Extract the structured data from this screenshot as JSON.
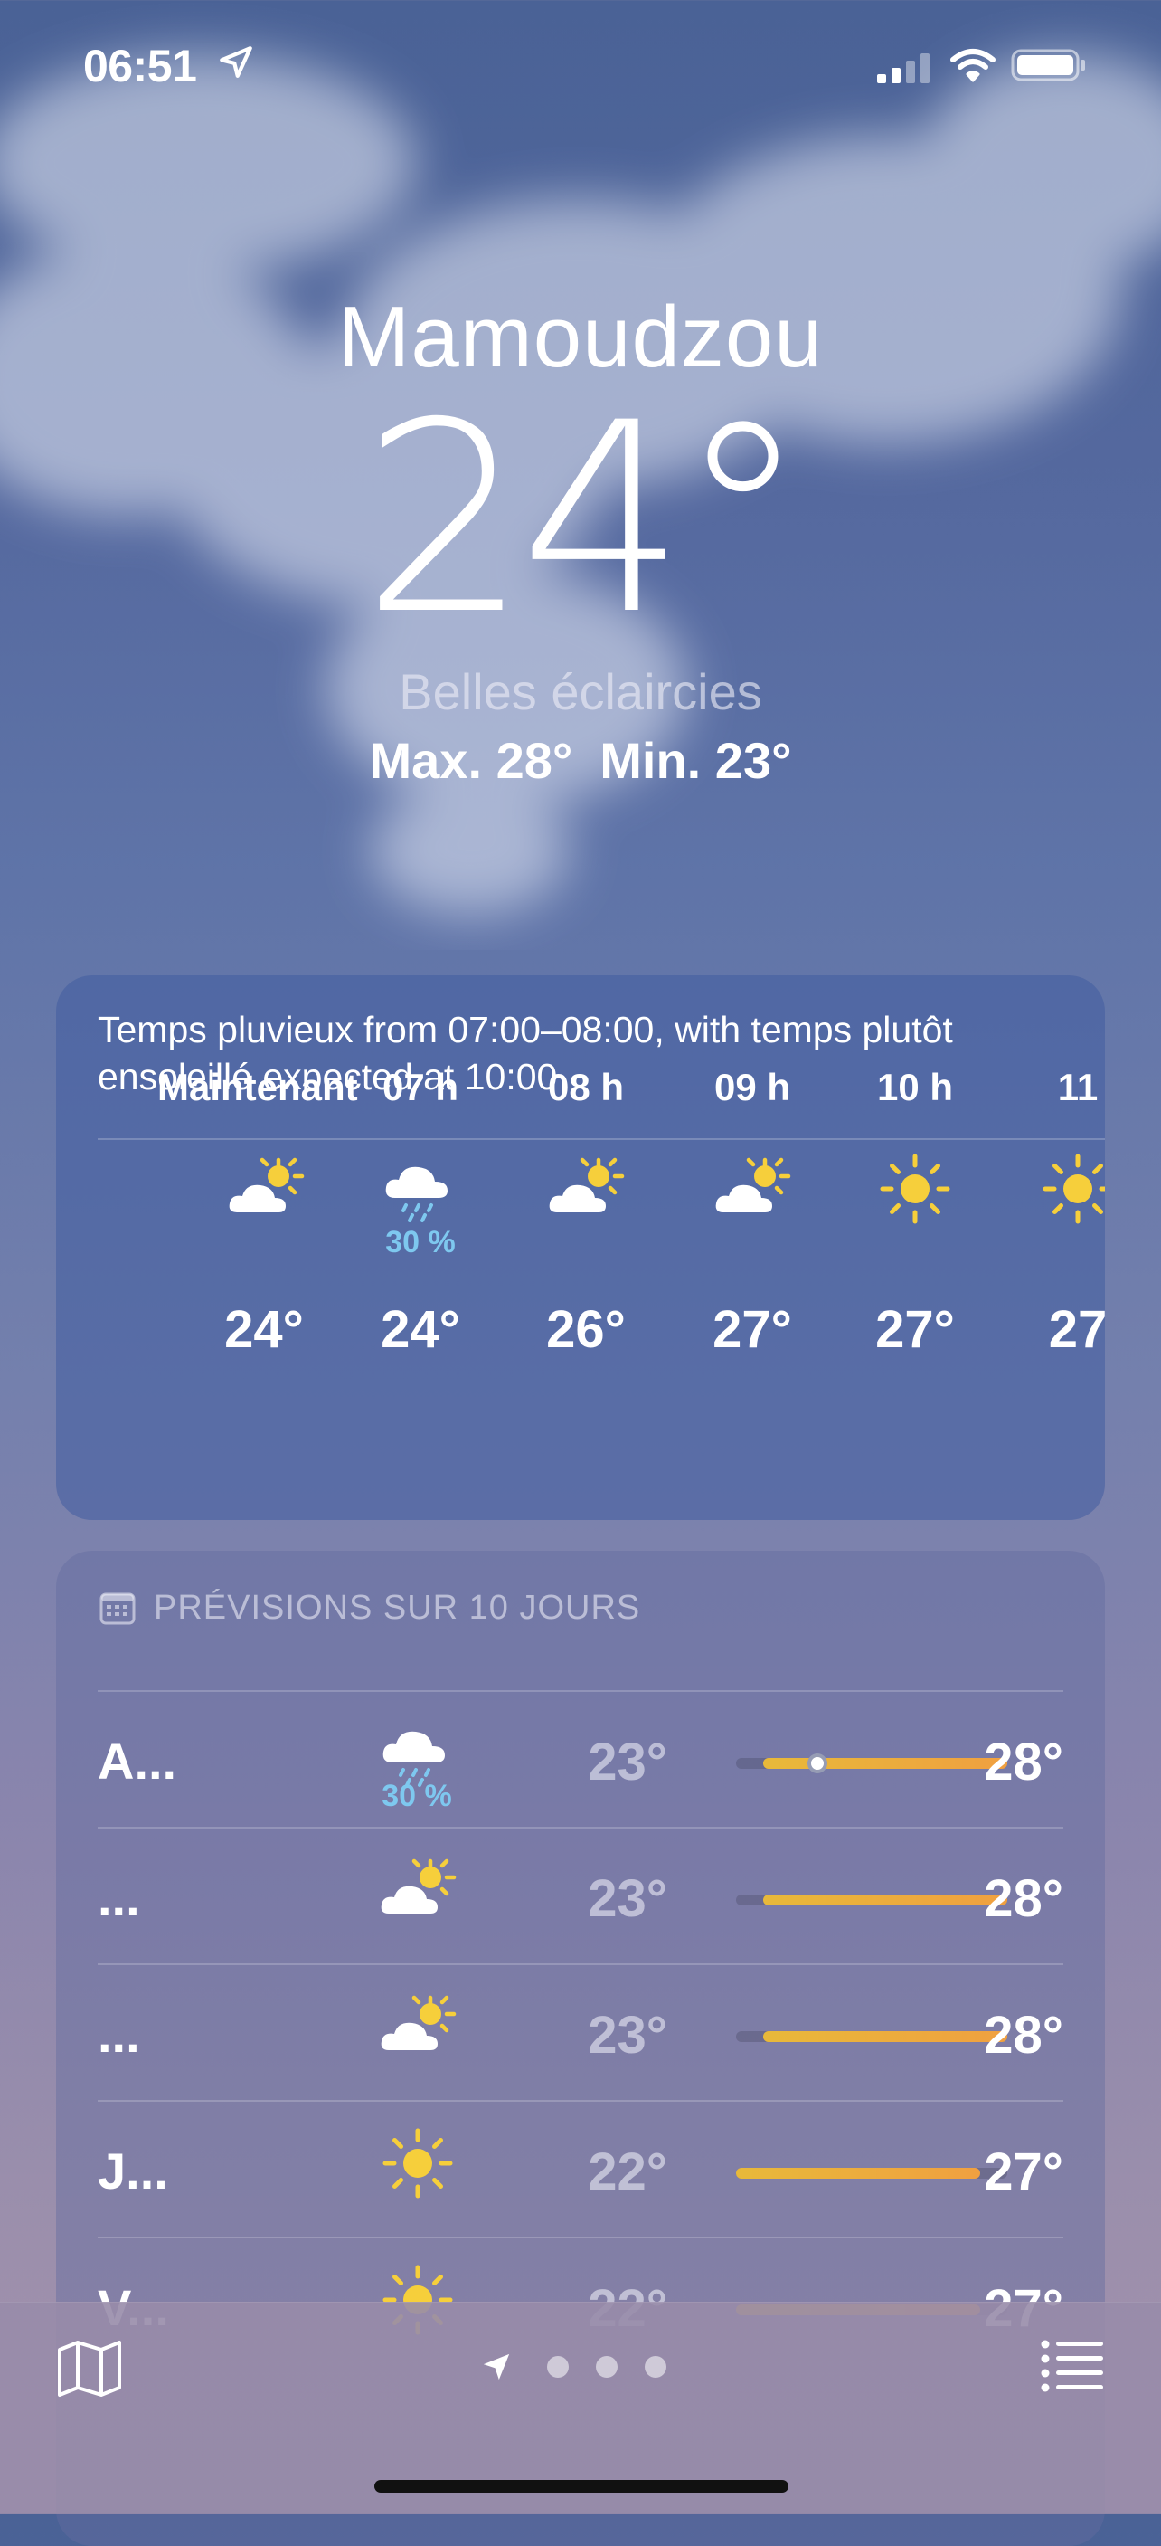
{
  "status_bar": {
    "time": "06:51"
  },
  "current": {
    "city": "Mamoudzou",
    "temperature": "24°",
    "condition": "Belles éclaircies",
    "high": "Max. 28°",
    "low": "Min. 23°"
  },
  "hourly": {
    "summary": "Temps pluvieux from 07:00–08:00, with temps plutôt ensoleillé expected at 10:00",
    "items": [
      {
        "label": "Maintenant",
        "icon": "partly-sunny-icon",
        "precip": "",
        "temp": "24°"
      },
      {
        "label": "07 h",
        "icon": "rain-cloud-icon",
        "precip": "30 %",
        "temp": "24°"
      },
      {
        "label": "08 h",
        "icon": "partly-sunny-icon",
        "precip": "",
        "temp": "26°"
      },
      {
        "label": "09 h",
        "icon": "partly-sunny-icon",
        "precip": "",
        "temp": "27°"
      },
      {
        "label": "10 h",
        "icon": "sun-icon",
        "precip": "",
        "temp": "27°"
      },
      {
        "label": "11",
        "icon": "sun-icon",
        "precip": "",
        "temp": "27"
      }
    ]
  },
  "daily": {
    "header": "PRÉVISIONS SUR 10 JOURS",
    "items": [
      {
        "day": "A...",
        "icon": "rain-cloud-icon",
        "precip": "30 %",
        "low": "23°",
        "high": "28°",
        "range_start": 0.1,
        "range_end": 1.0,
        "current_marker": 0.3
      },
      {
        "day": "...",
        "icon": "partly-sunny-icon",
        "precip": "",
        "low": "23°",
        "high": "28°",
        "range_start": 0.1,
        "range_end": 1.0
      },
      {
        "day": "...",
        "icon": "partly-sunny-icon",
        "precip": "",
        "low": "23°",
        "high": "28°",
        "range_start": 0.1,
        "range_end": 1.0
      },
      {
        "day": "J...",
        "icon": "sun-icon",
        "precip": "",
        "low": "22°",
        "high": "27°",
        "range_start": 0.0,
        "range_end": 0.9
      },
      {
        "day": "V...",
        "icon": "sun-icon",
        "precip": "",
        "low": "22°",
        "high": "27°",
        "range_start": 0.0,
        "range_end": 0.9
      }
    ]
  },
  "toolbar": {
    "page_count": 3
  },
  "colors": {
    "rain_percent": "#7ec8ef",
    "sun": "#f6cf3b",
    "bar_start": "#e8b93a",
    "bar_end": "#f0a040"
  }
}
